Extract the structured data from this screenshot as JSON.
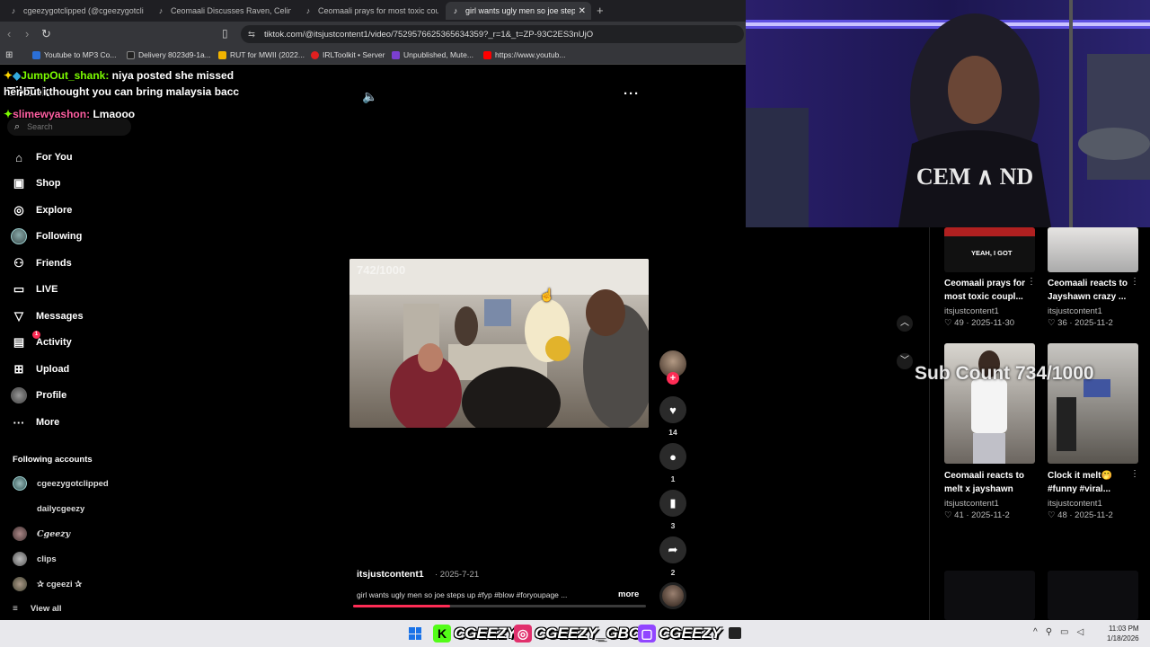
{
  "browser": {
    "tabs": [
      {
        "title": "cgeezygotclipped (@cgeezygotclipp",
        "icon": "tiktok-icon"
      },
      {
        "title": "Ceomaali Discusses Raven, Celine an",
        "icon": "tiktok-icon"
      },
      {
        "title": "Ceomaali prays for most toxic couple",
        "icon": "tiktok-icon"
      },
      {
        "title": "girl wants ugly men so joe steps",
        "icon": "tiktok-icon",
        "active": true
      }
    ],
    "url": "tiktok.com/@itsjustcontent1/video/7529576625365634359?_r=1&_t=ZP-93C2ES3nUjO",
    "bookmarks": [
      {
        "label": "Youtube to MP3 Co...",
        "color": "#2b6fd6"
      },
      {
        "label": "Delivery 8023d9-1a...",
        "color": "#222222"
      },
      {
        "label": "RUT for MWII (2022...",
        "color": "#f2b400"
      },
      {
        "label": "IRLToolkit • Server",
        "color": "#e02020"
      },
      {
        "label": "Unpublished, Mute...",
        "color": "#7b3fd0"
      },
      {
        "label": "https://www.youtub...",
        "color": "#ff0000"
      }
    ]
  },
  "chat": [
    {
      "user": "JumpOut_shank:",
      "message": "niya posted she missed"
    },
    {
      "user": "",
      "message": "her but i thought you can bring malaysia bacc"
    },
    {
      "user": "slimewyashon:",
      "message": "Lmaooo"
    }
  ],
  "tiktok": {
    "logo": "TikTok",
    "search_placeholder": "Search",
    "nav": [
      {
        "label": "For You",
        "icon": "home-icon"
      },
      {
        "label": "Shop",
        "icon": "shop-bag-icon"
      },
      {
        "label": "Explore",
        "icon": "compass-icon"
      },
      {
        "label": "Following",
        "icon": "avatar-icon"
      },
      {
        "label": "Friends",
        "icon": "friends-icon"
      },
      {
        "label": "LIVE",
        "icon": "live-tv-icon"
      },
      {
        "label": "Messages",
        "icon": "messages-icon"
      },
      {
        "label": "Activity",
        "icon": "activity-icon",
        "badge": "1"
      },
      {
        "label": "Upload",
        "icon": "upload-plus-icon"
      },
      {
        "label": "Profile",
        "icon": "profile-avatar-icon"
      },
      {
        "label": "More",
        "icon": "more-dots-icon"
      }
    ],
    "following_title": "Following accounts",
    "following_accounts": [
      "cgeezygotclipped",
      "dailycgeezy",
      "Cgeezy",
      "clips",
      "✰ cgeezi ✰"
    ],
    "view_all": "View all"
  },
  "video": {
    "overlay_text": "742/1000",
    "author": "itsjustcontent1",
    "date": "· 2025-7-21",
    "caption": "girl wants ugly men so joe steps up #fyp #blow #foryoupage ...",
    "more": "more",
    "progress": 0.33,
    "likes": "14",
    "comments": "1",
    "saves": "3",
    "shares": "2"
  },
  "recommended": [
    {
      "title": "Ceomaali prays for most toxic coupl...",
      "author": "itsjustcontent1",
      "meta": "♡ 49 · 2025-11-30",
      "thumb_text": "YEAH, I GOT"
    },
    {
      "title": "Ceomaali reacts to Jayshawn crazy ...",
      "author": "itsjustcontent1",
      "meta": "♡ 36 · 2025-11-2",
      "thumb_text": ""
    },
    {
      "title": "Ceomaali reacts to melt x jayshawn",
      "author": "itsjustcontent1",
      "meta": "♡ 41 · 2025-11-2",
      "thumb_text": ""
    },
    {
      "title": "Clock it melt🤭 #funny #viral...",
      "author": "itsjustcontent1",
      "meta": "♡ 48 · 2025-11-2",
      "thumb_text": ""
    }
  ],
  "sub_count": "Sub Count 734/1000",
  "taskbar": {
    "brands": [
      {
        "label": "CGEEZY",
        "icon": "kick-icon",
        "color": "#53fc18"
      },
      {
        "label": "CGEEZY_GBC",
        "icon": "instagram-icon",
        "color": "#e1306c"
      },
      {
        "label": "CGEEZY",
        "icon": "twitch-icon",
        "color": "#9146ff"
      }
    ],
    "time": "11:03 PM",
    "date": "1/18/2026"
  }
}
